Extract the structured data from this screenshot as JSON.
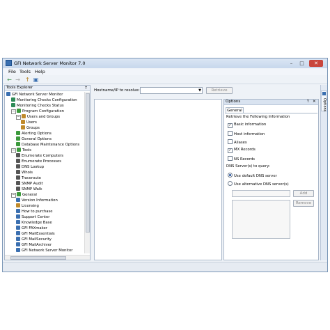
{
  "window": {
    "title": "GFI Network Server Monitor 7.0",
    "buttons": {
      "minimize": "–",
      "maximize": "□",
      "close": "✕"
    }
  },
  "menu": [
    {
      "label": "File"
    },
    {
      "label": "Tools"
    },
    {
      "label": "Help"
    }
  ],
  "toolbar": {
    "back": "←",
    "forward": "→",
    "up": "↑",
    "view": "▣"
  },
  "explorer": {
    "title": "Tools Explorer",
    "pin": "↑",
    "items": [
      {
        "label": "GFI Network Server Monitor",
        "icon": "network-icon",
        "color": "#3a6fb0"
      },
      {
        "label": "Monitoring Checks Configuration",
        "icon": "config-icon",
        "color": "#2e8b57"
      },
      {
        "label": "Monitoring Checks Status",
        "icon": "status-icon",
        "color": "#2e8b57"
      },
      {
        "label": "Program Configuration",
        "icon": "settings-icon",
        "color": "#3c9a3c"
      },
      {
        "label": "Users and Groups",
        "icon": "users-icon",
        "color": "#c08a2a"
      },
      {
        "label": "Users",
        "icon": "user-icon",
        "color": "#c08a2a"
      },
      {
        "label": "Groups",
        "icon": "group-icon",
        "color": "#c08a2a"
      },
      {
        "label": "Alerting Options",
        "icon": "alert-icon",
        "color": "#3c9a3c"
      },
      {
        "label": "General Options",
        "icon": "options-icon",
        "color": "#3c9a3c"
      },
      {
        "label": "Database Maintenance Options",
        "icon": "database-icon",
        "color": "#3c9a3c"
      },
      {
        "label": "Tools",
        "icon": "tools-icon",
        "color": "#3c9a3c"
      },
      {
        "label": "Enumerate Computers",
        "icon": "tool-icon",
        "color": "#555555"
      },
      {
        "label": "Enumerate Processes",
        "icon": "tool-icon",
        "color": "#555555"
      },
      {
        "label": "DNS Lookup",
        "icon": "tool-icon",
        "color": "#555555"
      },
      {
        "label": "Whois",
        "icon": "tool-icon",
        "color": "#555555"
      },
      {
        "label": "Traceroute",
        "icon": "tool-icon",
        "color": "#555555"
      },
      {
        "label": "SNMP Audit",
        "icon": "tool-icon",
        "color": "#555555"
      },
      {
        "label": "SNMP Walk",
        "icon": "tool-icon",
        "color": "#555555"
      },
      {
        "label": "General",
        "icon": "general-icon",
        "color": "#3c9a3c"
      },
      {
        "label": "Version Information",
        "icon": "info-icon",
        "color": "#3a6fb0"
      },
      {
        "label": "Licensing",
        "icon": "license-icon",
        "color": "#c08a2a"
      },
      {
        "label": "How to purchase",
        "icon": "purchase-icon",
        "color": "#3a6fb0"
      },
      {
        "label": "Support Center",
        "icon": "support-icon",
        "color": "#3a6fb0"
      },
      {
        "label": "Knowledge Base",
        "icon": "knowledge-icon",
        "color": "#3a6fb0"
      },
      {
        "label": "GFI FAXmaker",
        "icon": "product-icon",
        "color": "#3a6fb0"
      },
      {
        "label": "GFI MailEssentials",
        "icon": "product-icon",
        "color": "#3a6fb0"
      },
      {
        "label": "GFI MailSecurity",
        "icon": "product-icon",
        "color": "#3a6fb0"
      },
      {
        "label": "GFI MailArchiver",
        "icon": "product-icon",
        "color": "#3a6fb0"
      },
      {
        "label": "GFI Network Server Monitor",
        "icon": "product-icon",
        "color": "#3a6fb0"
      }
    ]
  },
  "lookup": {
    "label": "Hostname/IP to resolve:",
    "value": "",
    "resolve_label": "Retrieve"
  },
  "options": {
    "title": "Options",
    "tab": "General",
    "retrieve_heading": "Retrieve the Following Information",
    "checks": [
      {
        "label": "Basic information",
        "checked": true
      },
      {
        "label": "Host information",
        "checked": false
      },
      {
        "label": "Aliases",
        "checked": false
      },
      {
        "label": "MX Records",
        "checked": true
      },
      {
        "label": "NS Records",
        "checked": false
      }
    ],
    "dns_heading": "DNS Server(s) to query:",
    "radios": [
      {
        "label": "Use default DNS server",
        "selected": true
      },
      {
        "label": "Use alternative DNS server(s)",
        "selected": false
      }
    ],
    "add_label": "Add",
    "remove_label": "Remove",
    "side_tab": "Options",
    "pin": "↑",
    "close": "✕"
  }
}
